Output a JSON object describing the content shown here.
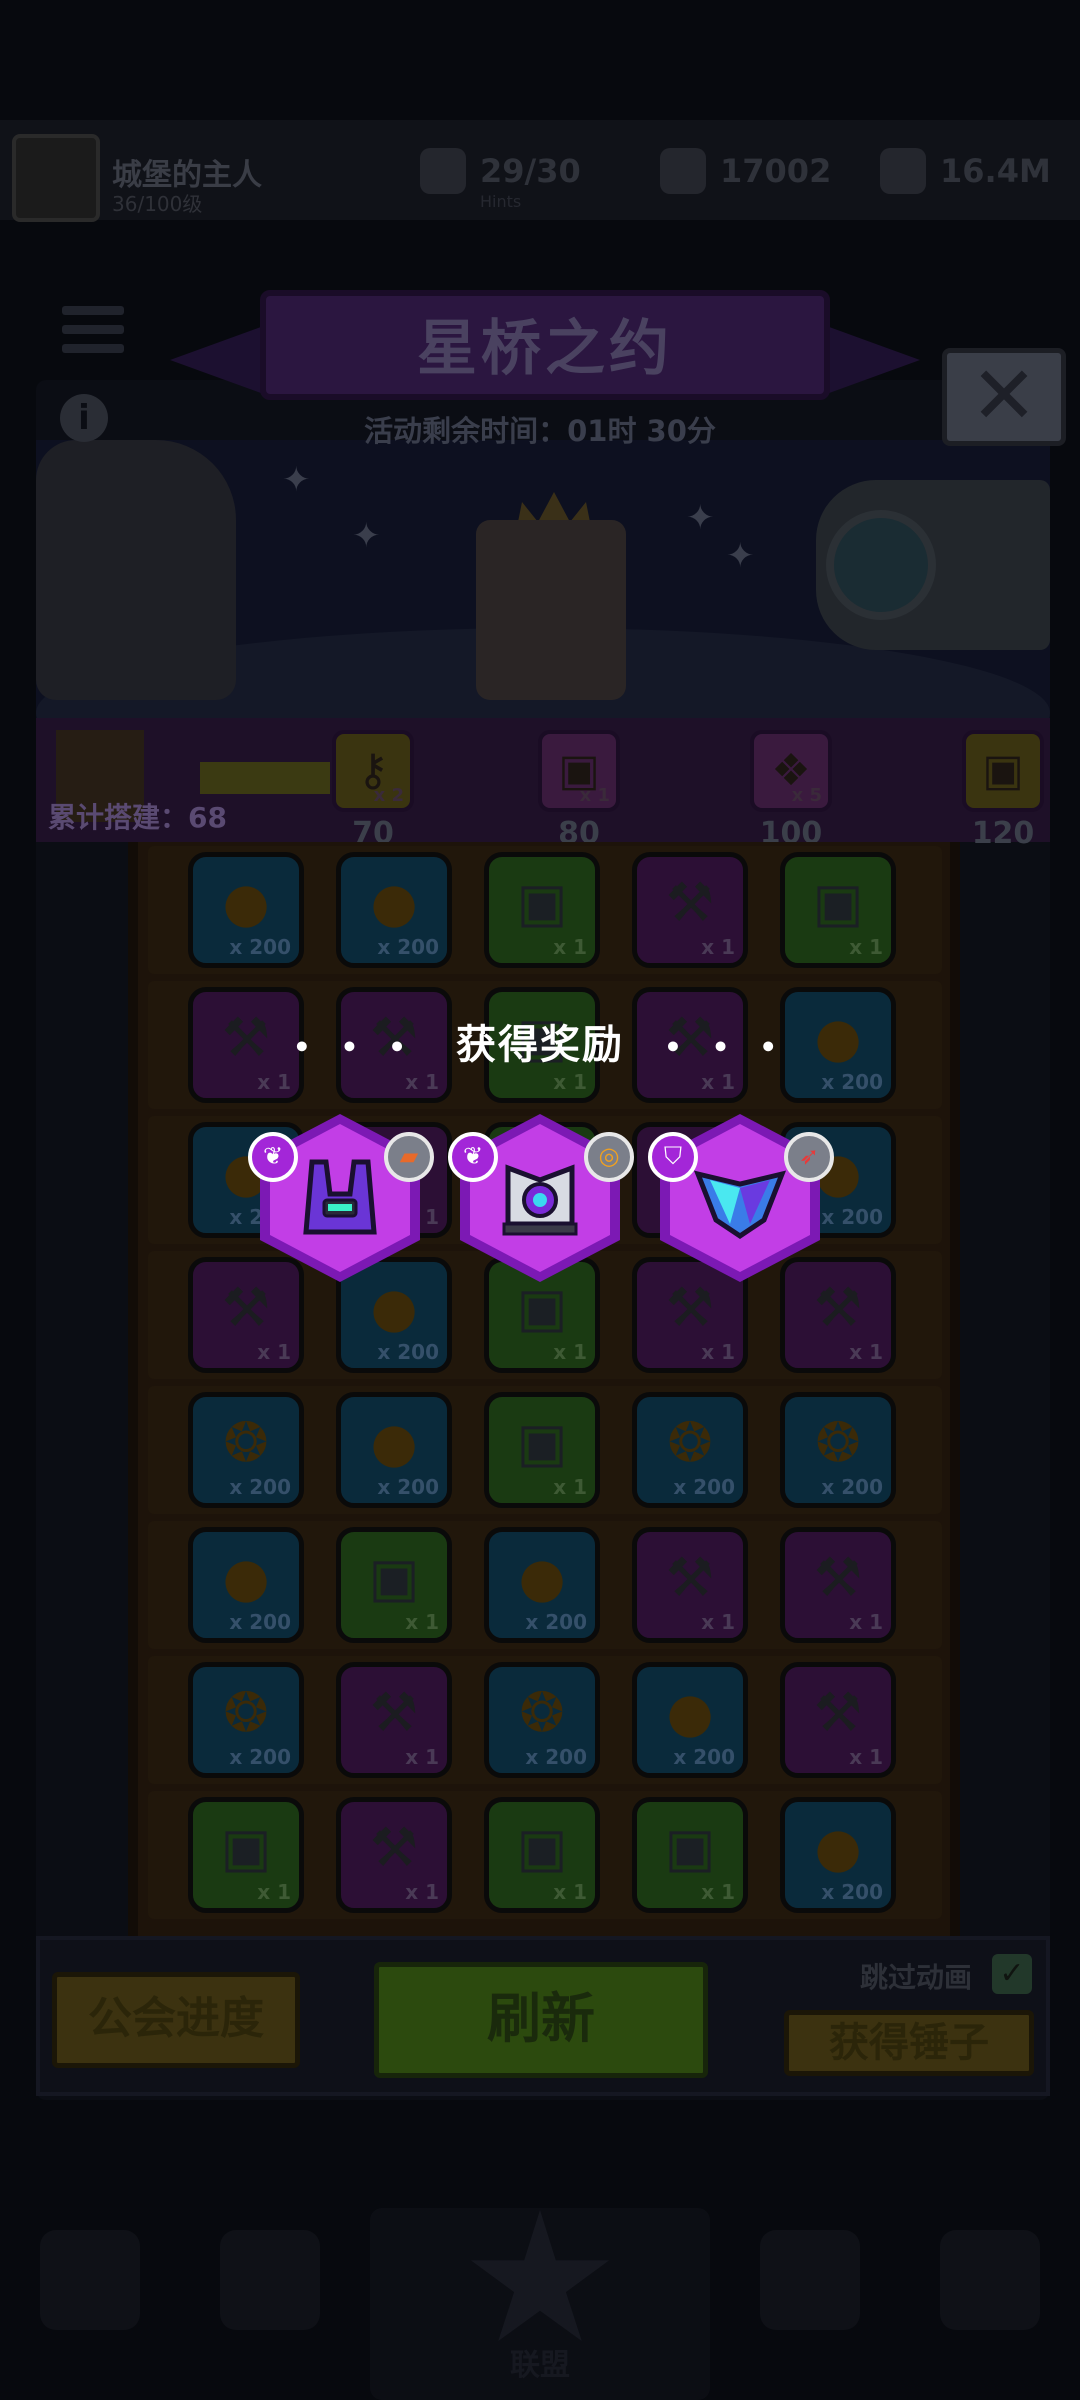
{
  "topbar": {
    "guild_name": "城堡的主人",
    "guild_sub": "36/100级",
    "stats": [
      {
        "value": "29/30",
        "sub": "Hints"
      },
      {
        "value": "17002",
        "sub": ""
      },
      {
        "value": "16.4M",
        "sub": ""
      }
    ]
  },
  "event": {
    "title": "星桥之约",
    "timer": "活动剩余时间：01时 30分"
  },
  "icons": {
    "menu": "menu-icon",
    "info": "info-icon",
    "close": "close-icon"
  },
  "progress": {
    "label": "累计搭建：68",
    "milestones": [
      {
        "value": "70",
        "qty": "x 2",
        "color": "#3a3410"
      },
      {
        "value": "80",
        "qty": "x 1",
        "color": "#3a1a3e"
      },
      {
        "value": "100",
        "qty": "x 5",
        "color": "#3a1a3e"
      },
      {
        "value": "120",
        "qty": "",
        "color": "#3a3410"
      }
    ]
  },
  "grid": [
    [
      {
        "t": "blue",
        "i": "drop",
        "q": "x 200"
      },
      {
        "t": "blue",
        "i": "drop",
        "q": "x 200"
      },
      {
        "t": "green",
        "i": "chest",
        "q": "x 1"
      },
      {
        "t": "purple",
        "i": "hammer",
        "q": "x 1"
      },
      {
        "t": "green",
        "i": "chest",
        "q": "x 1"
      }
    ],
    [
      {
        "t": "purple",
        "i": "hammer",
        "q": "x 1"
      },
      {
        "t": "purple",
        "i": "hammer",
        "q": "x 1"
      },
      {
        "t": "green",
        "i": "chest",
        "q": "x 1"
      },
      {
        "t": "purple",
        "i": "hammer",
        "q": "x 1"
      },
      {
        "t": "blue",
        "i": "drop",
        "q": "x 200"
      }
    ],
    [
      {
        "t": "blue",
        "i": "drop",
        "q": "x 200"
      },
      {
        "t": "purple",
        "i": "hammer",
        "q": "x 1"
      },
      {
        "t": "green",
        "i": "chest",
        "q": "x 1"
      },
      {
        "t": "purple",
        "i": "hammer",
        "q": "x 1"
      },
      {
        "t": "blue",
        "i": "drop",
        "q": "x 200"
      }
    ],
    [
      {
        "t": "purple",
        "i": "hammer",
        "q": "x 1"
      },
      {
        "t": "blue",
        "i": "drop",
        "q": "x 200"
      },
      {
        "t": "green",
        "i": "chest",
        "q": "x 1"
      },
      {
        "t": "purple",
        "i": "hammer",
        "q": "x 1"
      },
      {
        "t": "purple",
        "i": "hammer",
        "q": "x 1"
      }
    ],
    [
      {
        "t": "blue",
        "i": "coin",
        "q": "x 200"
      },
      {
        "t": "blue",
        "i": "drop",
        "q": "x 200"
      },
      {
        "t": "green",
        "i": "chest",
        "q": "x 1"
      },
      {
        "t": "blue",
        "i": "coin",
        "q": "x 200"
      },
      {
        "t": "blue",
        "i": "coin",
        "q": "x 200"
      }
    ],
    [
      {
        "t": "blue",
        "i": "drop",
        "q": "x 200"
      },
      {
        "t": "green",
        "i": "chest",
        "q": "x 1"
      },
      {
        "t": "blue",
        "i": "drop",
        "q": "x 200"
      },
      {
        "t": "purple",
        "i": "hammer",
        "q": "x 1"
      },
      {
        "t": "purple",
        "i": "hammer",
        "q": "x 1"
      }
    ],
    [
      {
        "t": "blue",
        "i": "coin",
        "q": "x 200"
      },
      {
        "t": "purple",
        "i": "hammer",
        "q": "x 1"
      },
      {
        "t": "blue",
        "i": "coin",
        "q": "x 200"
      },
      {
        "t": "blue",
        "i": "drop",
        "q": "x 200"
      },
      {
        "t": "purple",
        "i": "hammer",
        "q": "x 1"
      }
    ],
    [
      {
        "t": "green",
        "i": "chest",
        "q": "x 1"
      },
      {
        "t": "purple",
        "i": "hammer",
        "q": "x 1"
      },
      {
        "t": "green",
        "i": "chest",
        "q": "x 1"
      },
      {
        "t": "green",
        "i": "chest",
        "q": "x 1"
      },
      {
        "t": "blue",
        "i": "drop",
        "q": "x 200"
      }
    ]
  ],
  "reward_popup": {
    "title": "获得奖励",
    "dots_left": "• • •",
    "dots_right": "• • •",
    "items": [
      {
        "name": "armor-vest-icon",
        "badge_left": "wing-badge-icon",
        "badge_right": "card-badge-icon"
      },
      {
        "name": "eye-device-icon",
        "badge_left": "wing-badge-icon",
        "badge_right": "spiral-badge-icon"
      },
      {
        "name": "crystal-shield-icon",
        "badge_left": "shield-badge-icon",
        "badge_right": "rocket-badge-icon"
      }
    ]
  },
  "actions": {
    "guild_progress": "公会进度",
    "refresh": "刷新",
    "skip_animation": "跳过动画",
    "skip_checked": "✓",
    "get_hammer": "获得锤子"
  },
  "nav": {
    "center_label": "联盟"
  }
}
